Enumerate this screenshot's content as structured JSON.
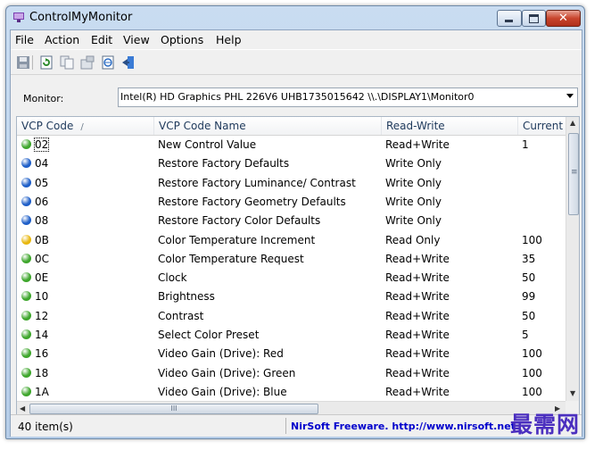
{
  "window": {
    "title": "ControlMyMonitor",
    "close_glyph": "✕"
  },
  "menu": [
    "File",
    "Action",
    "Edit",
    "View",
    "Options",
    "Help"
  ],
  "toolbar_icons": [
    "save-icon",
    "refresh-icon",
    "copy-icon",
    "properties-icon",
    "html-report-icon",
    "exit-icon"
  ],
  "monitor": {
    "label": "Monitor:",
    "selected": "Intel(R) HD Graphics  PHL 226V6  UHB1735015642  \\\\.\\DISPLAY1\\Monitor0"
  },
  "list": {
    "columns": [
      "VCP Code",
      "VCP Code Name",
      "Read-Write",
      "Current Value"
    ],
    "sort_indicator": "/",
    "rows": [
      {
        "code": "02",
        "name": "New Control Value",
        "rw": "Read+Write",
        "current": "1",
        "status": "green"
      },
      {
        "code": "04",
        "name": "Restore Factory Defaults",
        "rw": "Write Only",
        "current": "",
        "status": "blue"
      },
      {
        "code": "05",
        "name": "Restore Factory Luminance/ Contrast",
        "rw": "Write Only",
        "current": "",
        "status": "blue"
      },
      {
        "code": "06",
        "name": "Restore Factory Geometry Defaults",
        "rw": "Write Only",
        "current": "",
        "status": "blue"
      },
      {
        "code": "08",
        "name": "Restore Factory Color Defaults",
        "rw": "Write Only",
        "current": "",
        "status": "blue"
      },
      {
        "code": "0B",
        "name": "Color Temperature Increment",
        "rw": "Read Only",
        "current": "100",
        "status": "yellow"
      },
      {
        "code": "0C",
        "name": "Color Temperature Request",
        "rw": "Read+Write",
        "current": "35",
        "status": "green"
      },
      {
        "code": "0E",
        "name": "Clock",
        "rw": "Read+Write",
        "current": "50",
        "status": "green"
      },
      {
        "code": "10",
        "name": "Brightness",
        "rw": "Read+Write",
        "current": "99",
        "status": "green"
      },
      {
        "code": "12",
        "name": "Contrast",
        "rw": "Read+Write",
        "current": "50",
        "status": "green"
      },
      {
        "code": "14",
        "name": "Select Color Preset",
        "rw": "Read+Write",
        "current": "5",
        "status": "green"
      },
      {
        "code": "16",
        "name": "Video Gain (Drive): Red",
        "rw": "Read+Write",
        "current": "100",
        "status": "green"
      },
      {
        "code": "18",
        "name": "Video Gain (Drive): Green",
        "rw": "Read+Write",
        "current": "100",
        "status": "green"
      },
      {
        "code": "1A",
        "name": "Video Gain (Drive): Blue",
        "rw": "Read+Write",
        "current": "100",
        "status": "green"
      }
    ]
  },
  "scroll": {
    "h_thumb_grip": "III",
    "v_thumb_grip": "≡"
  },
  "status": {
    "count": "40 item(s)",
    "link": "NirSoft Freeware.  http://www.nirsoft.net"
  },
  "watermark": "最需网",
  "colors": {
    "green": "#3ea62c",
    "blue": "#1f5fc8",
    "yellow": "#e8b70e",
    "link": "#0000cc"
  }
}
